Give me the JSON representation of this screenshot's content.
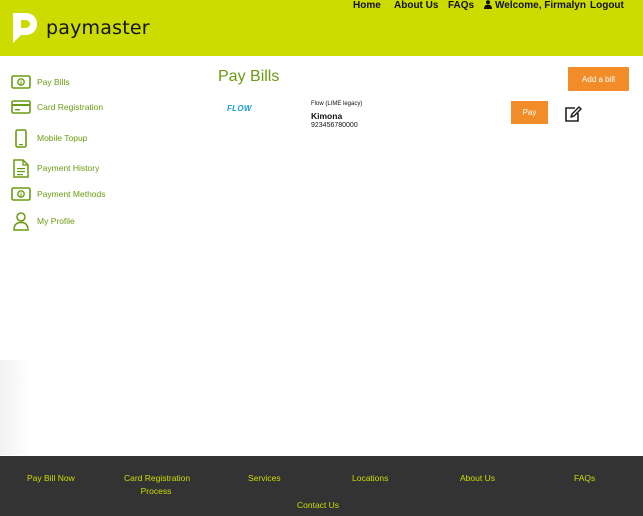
{
  "brand": {
    "name": "paymaster",
    "accent": "#cddc00",
    "green_text": "#6a9b10",
    "orange": "#f28c28",
    "footer_bg": "#333333"
  },
  "nav": {
    "home": "Home",
    "about": "About Us",
    "faqs": "FAQs",
    "welcome": "Welcome, Firmalyn",
    "logout": "Logout"
  },
  "sidebar": {
    "items": [
      {
        "label": "Pay Bills",
        "icon": "bill-icon"
      },
      {
        "label": "Card Registration",
        "icon": "card-icon"
      },
      {
        "label": "Mobile Topup",
        "icon": "mobile-icon"
      },
      {
        "label": "Payment History",
        "icon": "document-icon"
      },
      {
        "label": "Payment Methods",
        "icon": "bill-icon"
      },
      {
        "label": "My Profile",
        "icon": "user-icon"
      }
    ]
  },
  "main": {
    "title": "Pay Bills",
    "add_bill_label": "Add a bill",
    "bills": [
      {
        "logo_text": "FLOW",
        "provider": "Flow (LIME legacy)",
        "name": "Kimona",
        "account": "923456780000",
        "pay_label": "Pay",
        "edit_icon": "edit-icon"
      }
    ]
  },
  "footer": {
    "pay_bill_now": "Pay Bill Now",
    "card_registration_1": "Card Registration",
    "card_registration_2": "Process",
    "services": "Services",
    "locations": "Locations",
    "about_us": "About Us",
    "faqs": "FAQs",
    "contact_us": "Contact Us"
  }
}
